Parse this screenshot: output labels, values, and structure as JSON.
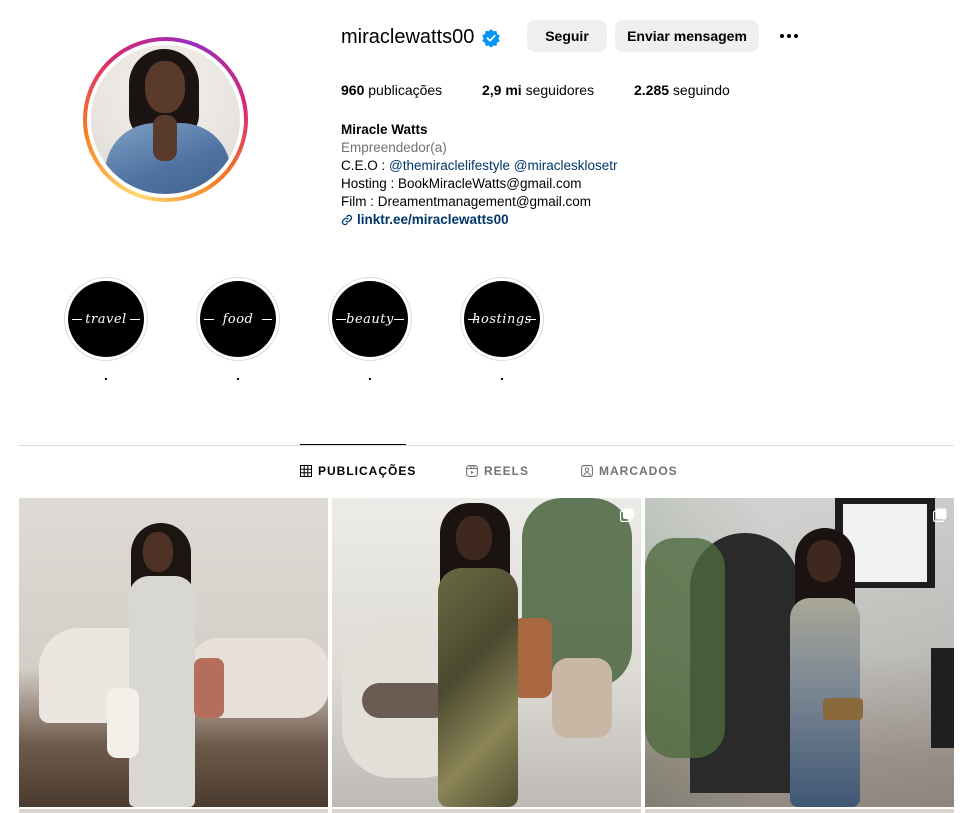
{
  "profile": {
    "username": "miraclewatts00",
    "verified": true,
    "follow_label": "Seguir",
    "message_label": "Enviar mensagem",
    "stats": {
      "posts_count": "960",
      "posts_label": " publicações",
      "followers_count": "2,9 mi",
      "followers_label": " seguidores",
      "following_count": "2.285",
      "following_label": " seguindo"
    },
    "bio": {
      "name": "Miracle Watts",
      "category": "Empreendedor(a)",
      "ceo_prefix": "C.E.O : ",
      "mention_1": "@themiraclelifestyle",
      "mention_2": "@miraclesklosetr",
      "hosting": "Hosting : BookMiracleWatts@gmail.com",
      "film": "Film : Dreamentmanagement@gmail.com",
      "link": "linktr.ee/miraclewatts00"
    }
  },
  "highlights": [
    {
      "cover_text": "travel",
      "label": "."
    },
    {
      "cover_text": "food",
      "label": "."
    },
    {
      "cover_text": "beauty",
      "label": "."
    },
    {
      "cover_text": "hostings",
      "label": "."
    }
  ],
  "tabs": {
    "posts": "PUBLICAÇÕES",
    "reels": "REELS",
    "tagged": "MARCADOS"
  },
  "colors": {
    "link": "#00376b",
    "secondary_text": "#737373",
    "verified": "#0095f6",
    "button_bg": "#efefef"
  }
}
